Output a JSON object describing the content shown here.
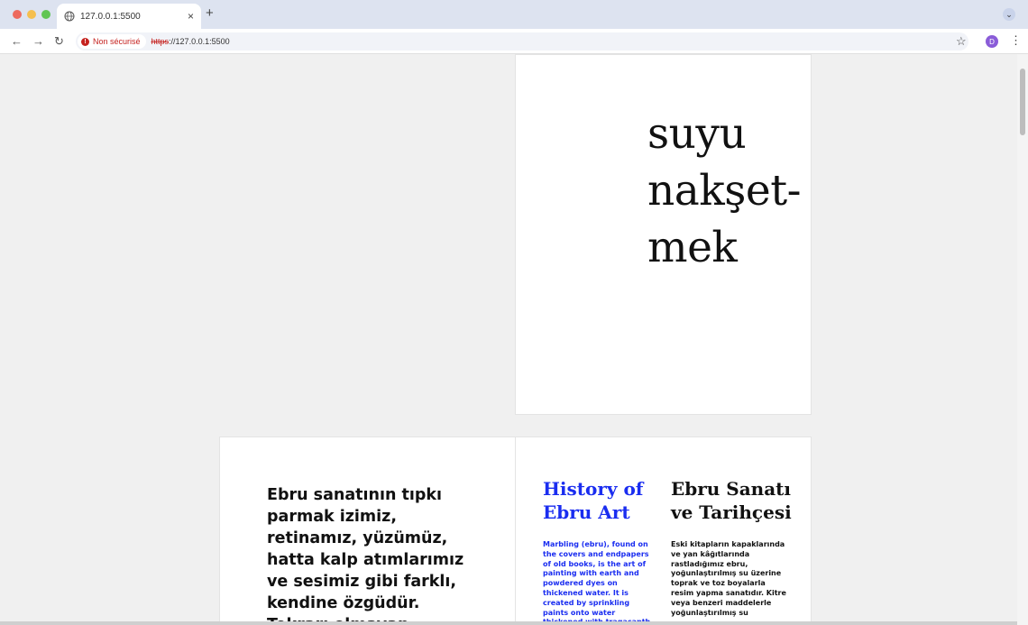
{
  "browser": {
    "tab_title": "127.0.0.1:5500",
    "tab_close": "×",
    "new_tab": "+",
    "tab_menu": "⌄",
    "security_label": "Non sécurisé",
    "url_scheme": "https",
    "url_rest": "://127.0.0.1:5500",
    "profile_initial": "D",
    "icons": [
      "globe-icon",
      "back-arrow-icon",
      "forward-arrow-icon",
      "reload-icon",
      "warning-icon",
      "star-icon",
      "kebab-menu-icon"
    ]
  },
  "page": {
    "hero_line1": "suyu",
    "hero_line2": "nakşet-",
    "hero_line3": "mek",
    "intro": "Ebru sanatının tıpkı parmak izimiz, retinamız, yüzümüz, hatta kalp atımlarımız ve sesimiz gibi farklı, kendine özgüdür. Tekrarı olmayan",
    "history_title": "History of Ebru Art",
    "history_body": "Marbling (ebru), found on the covers and endpapers of old books, is the art of painting with earth and powdered dyes on thickened water. It is created by sprinkling paints onto water thickened with tragacanth",
    "tr_title": "Ebru Sanatı ve Tarihçesi",
    "tr_body": "Eski kitapların kapaklarında ve yan kâğıtlarında rastladığımız ebru, yoğunlaştırılmış su üzerine toprak ve toz boyalarla resim yapma sanatıdır. Kitre veya benzeri maddelerle yoğunlaştırılmış su",
    "colors": {
      "accent_blue": "#1a2df0",
      "text": "#111111",
      "background": "#f0f0f0"
    }
  }
}
